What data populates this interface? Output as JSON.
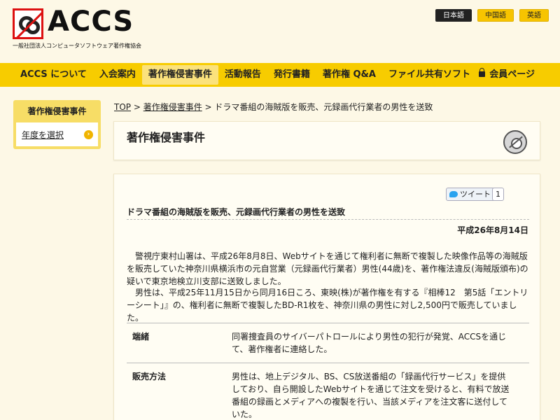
{
  "header": {
    "logo_text": "ACCS",
    "logo_sub": "一般社団法人コンピュータソフトウェア著作権協会",
    "languages": [
      {
        "label": "日本語",
        "active": true
      },
      {
        "label": "中国語",
        "active": false
      },
      {
        "label": "英語",
        "active": false
      }
    ]
  },
  "nav": {
    "items": [
      {
        "label": "ACCS について"
      },
      {
        "label": "入会案内"
      },
      {
        "label": "著作権侵害事件"
      },
      {
        "label": "活動報告"
      },
      {
        "label": "発行書籍"
      },
      {
        "label": "著作権 Q&A"
      },
      {
        "label": "ファイル共有ソフト"
      }
    ],
    "active_index": 2,
    "member_label": "会員ページ"
  },
  "sidebar": {
    "title": "著作権侵害事件",
    "item_label": "年度を選択"
  },
  "breadcrumb": {
    "top": "TOP",
    "sep1": " > ",
    "section": "著作権侵害事件",
    "sep2": " > ",
    "current": "ドラマ番組の海賊版を販売、元録画代行業者の男性を送致"
  },
  "section": {
    "title": "著作権侵害事件"
  },
  "article": {
    "tweet_label": "ツイート",
    "tweet_count": "1",
    "title": "ドラマ番組の海賊版を販売、元録画代行業者の男性を送致",
    "date": "平成26年8月14日",
    "para1": "警視庁東村山署は、平成26年8月8日、Webサイトを通じて権利者に無断で複製した映像作品等の海賊版を販売していた神奈川県横浜市の元自営業（元録画代行業者）男性(44歳)を、著作権法違反(海賊版頒布)の疑いで東京地検立川支部に送致しました。",
    "para2": "男性は、平成25年11月15日から同月16日ころ、東映(株)が著作権を有する『相棒12　第5話「エントリーシート」』の、権利者に無断で複製したBD-R1枚を、神奈川県の男性に対し2,500円で販売していました。",
    "table": [
      {
        "label": "端緒",
        "text": "同署捜査員のサイバーパトロールにより男性の犯行が発覚、ACCSを通じて、著作権者に連絡した。"
      },
      {
        "label": "販売方法",
        "text": "男性は、地上デジタル、BS、CS放送番組の「録画代行サービス」を提供しており、自ら開設したWebサイトを通じて注文を受けると、有料で放送番組の録画とメディアへの複製を行い、当該メディアを注文客に送付していた。"
      }
    ]
  }
}
